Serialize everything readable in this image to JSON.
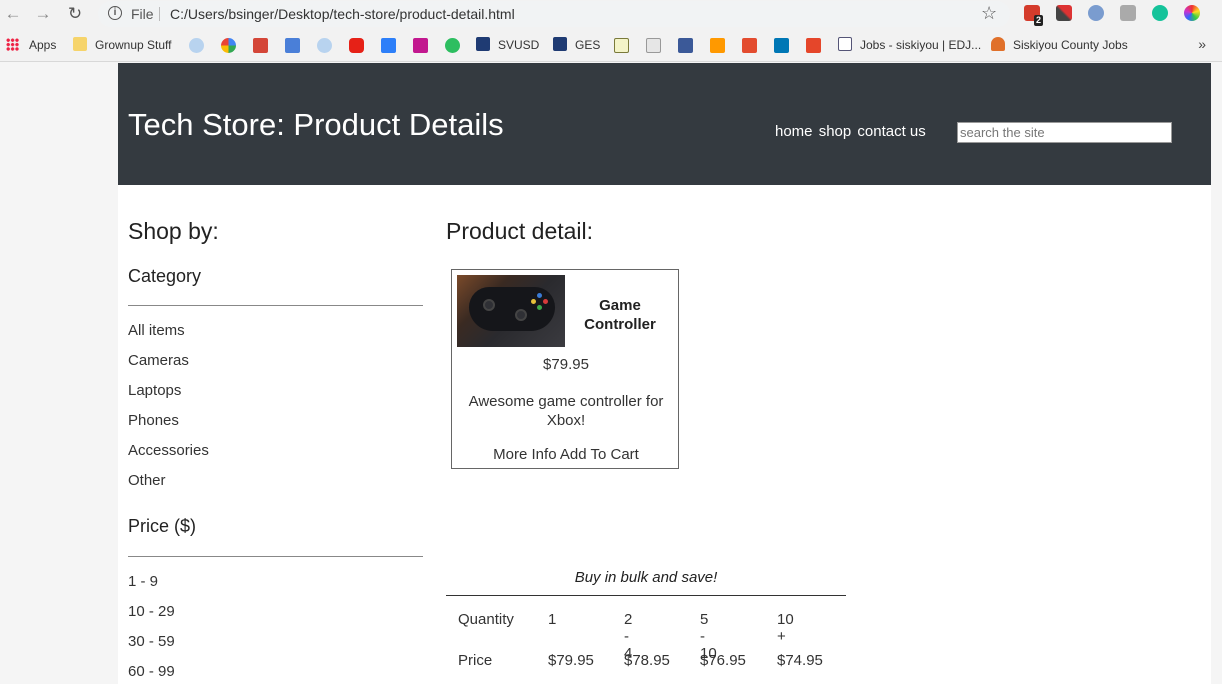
{
  "browser": {
    "file_label": "File",
    "url": "C:/Users/bsinger/Desktop/tech-store/product-detail.html",
    "extension_badge": "2",
    "bookmarks": [
      {
        "label": "Apps"
      },
      {
        "label": "Grownup Stuff"
      },
      {
        "label": "SVUSD"
      },
      {
        "label": "GES"
      },
      {
        "label": "Jobs - siskiyou | EDJ..."
      },
      {
        "label": "Siskiyou County Jobs"
      }
    ],
    "overflow_label": "»"
  },
  "site": {
    "title": "Tech Store: Product Details",
    "nav": [
      "home",
      "shop",
      "contact us"
    ],
    "search_placeholder": "search the site"
  },
  "sidebar": {
    "heading": "Shop by:",
    "category_heading": "Category",
    "categories": [
      "All items",
      "Cameras",
      "Laptops",
      "Phones",
      "Accessories",
      "Other"
    ],
    "price_heading": "Price ($)",
    "price_ranges": [
      "1 - 9",
      "10 - 29",
      "30 - 59",
      "60 - 99"
    ]
  },
  "product": {
    "heading": "Product detail:",
    "name": "Game Controller",
    "price": "$79.95",
    "description": "Awesome game controller for Xbox!",
    "more_info": "More Info",
    "add_to_cart": "Add To Cart"
  },
  "bulk": {
    "caption": "Buy in bulk and save!",
    "rows": [
      [
        "Quantity",
        "1",
        "2 - 4",
        "5 - 10",
        "10 +"
      ],
      [
        "Price",
        "$79.95",
        "$78.95",
        "$76.95",
        "$74.95"
      ]
    ]
  }
}
